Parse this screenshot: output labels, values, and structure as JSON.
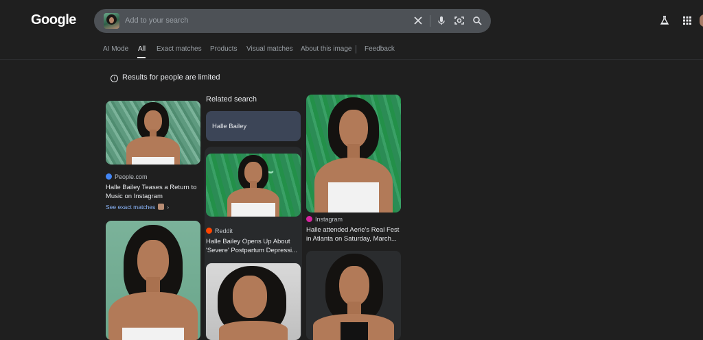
{
  "header": {
    "logo": "Google",
    "search": {
      "placeholder": "Add to your search",
      "icons": [
        "clear-icon",
        "microphone-icon",
        "lens-icon",
        "search-icon"
      ]
    },
    "right_icons": [
      "labs-flask-icon",
      "apps-grid-icon",
      "account-avatar"
    ]
  },
  "tabs": [
    {
      "label": "AI Mode",
      "active": false
    },
    {
      "label": "All",
      "active": true
    },
    {
      "label": "Exact matches",
      "active": false
    },
    {
      "label": "Products",
      "active": false
    },
    {
      "label": "Visual matches",
      "active": false
    },
    {
      "label": "About this image",
      "active": false
    },
    {
      "label": "Feedback",
      "active": false
    }
  ],
  "notice": "Results for people are limited",
  "results": {
    "col1": [
      {
        "source": "People.com",
        "source_color": "#4285f4",
        "title": "Halle Bailey Teases a Return to Music on Instagram",
        "exact_link": "See exact matches"
      }
    ],
    "related": {
      "heading": "Related search",
      "chip": "Halle Bailey"
    },
    "col2": [
      {
        "source": "Reddit",
        "source_color": "#ff4500",
        "title": "Halle Bailey Opens Up About 'Severe' Postpartum Depressi..."
      }
    ],
    "col3": [
      {
        "source": "Instagram",
        "source_color": "#d6249f",
        "title": "Halle attended Aerie's Real Fest in Atlanta on Saturday, March..."
      }
    ]
  }
}
